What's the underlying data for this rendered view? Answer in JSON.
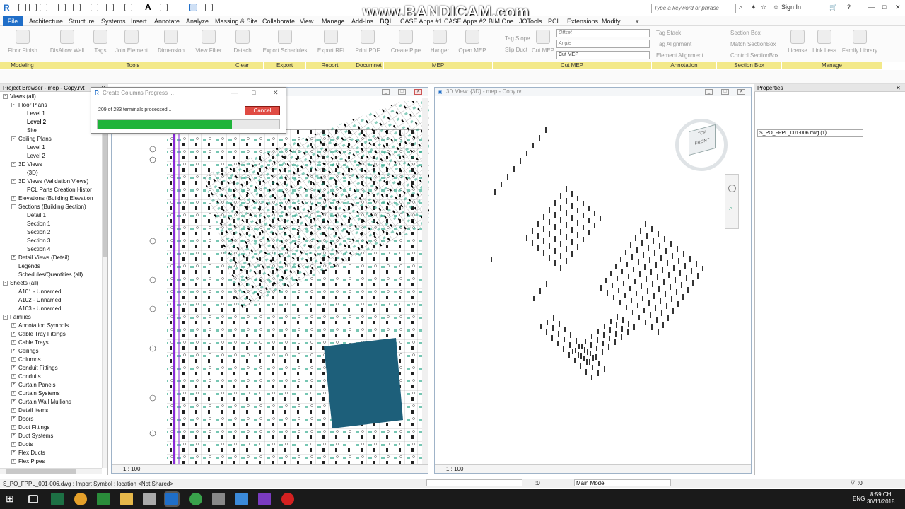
{
  "title_bar": {
    "watermark": "www.BANDICAM.com",
    "search_placeholder": "Type a keyword or phrase",
    "sign_in": "Sign In"
  },
  "menu": {
    "file": "File",
    "tabs": [
      "Architecture",
      "Structure",
      "Systems",
      "Insert",
      "Annotate",
      "Analyze",
      "Massing & Site",
      "Collaborate",
      "View",
      "Manage",
      "Add-Ins",
      "BQL",
      "CASE Apps #1",
      "CASE Apps #2",
      "BIM One",
      "JOTools",
      "PCL",
      "Extensions",
      "Modify"
    ]
  },
  "ribbon": {
    "tools": [
      "Floor Finish",
      "DisAllow Wall",
      "Tags",
      "Join Element",
      "Dimension",
      "View Filter",
      "Detach",
      "Export Schedules",
      "Export RFI",
      "Print PDF",
      "Create Pipe",
      "Hanger",
      "Open MEP"
    ],
    "cut_mep": {
      "tag_slope": "Tag Slope",
      "slip_duct": "Slip Duct",
      "cut_mep_label": "Cut MEP",
      "offset_placeholder": "Offset",
      "angle_placeholder": "Angle",
      "cut_mep_select": "Cut MEP"
    },
    "annotation": {
      "tag_stack": "Tag Stack",
      "tag_alignment": "Tag Alignment",
      "element_alignment": "Element Alignment"
    },
    "section_box": {
      "section_box": "Section Box",
      "match_section_box": "Match SectionBox",
      "control_section_box": "Control SectionBox"
    },
    "manage": [
      "License",
      "Link Less",
      "Family Library"
    ],
    "panels": [
      "Modeling",
      "Tools",
      "Clear",
      "Export",
      "Report",
      "Documnet",
      "MEP",
      "Cut MEP",
      "Annotation",
      "Section Box",
      "Manage"
    ]
  },
  "project_browser": {
    "title": "Project Browser - mep - Copy.rvt",
    "items": [
      {
        "label": "Views (all)",
        "toggle": "-"
      },
      {
        "label": "Floor Plans",
        "toggle": "-"
      },
      {
        "label": "Level 1",
        "toggle": ""
      },
      {
        "label": "Level 2",
        "toggle": ""
      },
      {
        "label": "Site",
        "toggle": ""
      },
      {
        "label": "Ceiling Plans",
        "toggle": "-"
      },
      {
        "label": "Level 1",
        "toggle": ""
      },
      {
        "label": "Level 2",
        "toggle": ""
      },
      {
        "label": "3D Views",
        "toggle": "-"
      },
      {
        "label": "{3D}",
        "toggle": ""
      },
      {
        "label": "3D Views (Validation Views)",
        "toggle": "-"
      },
      {
        "label": "PCL Parts Creation Histor",
        "toggle": ""
      },
      {
        "label": "Elevations (Building Elevation",
        "toggle": "+"
      },
      {
        "label": "Sections (Building Section)",
        "toggle": "-"
      },
      {
        "label": "Detail 1",
        "toggle": ""
      },
      {
        "label": "Section 1",
        "toggle": ""
      },
      {
        "label": "Section 2",
        "toggle": ""
      },
      {
        "label": "Section 3",
        "toggle": ""
      },
      {
        "label": "Section 4",
        "toggle": ""
      },
      {
        "label": "Detail Views (Detail)",
        "toggle": "+"
      },
      {
        "label": "Legends",
        "toggle": ""
      },
      {
        "label": "Schedules/Quantities (all)",
        "toggle": ""
      },
      {
        "label": "Sheets (all)",
        "toggle": "-"
      },
      {
        "label": "A101 - Unnamed",
        "toggle": ""
      },
      {
        "label": "A102 - Unnamed",
        "toggle": ""
      },
      {
        "label": "A103 - Unnamed",
        "toggle": ""
      },
      {
        "label": "Families",
        "toggle": "-"
      },
      {
        "label": "Annotation Symbols",
        "toggle": "+"
      },
      {
        "label": "Cable Tray Fittings",
        "toggle": "+"
      },
      {
        "label": "Cable Trays",
        "toggle": "+"
      },
      {
        "label": "Ceilings",
        "toggle": "+"
      },
      {
        "label": "Columns",
        "toggle": "+"
      },
      {
        "label": "Conduit Fittings",
        "toggle": "+"
      },
      {
        "label": "Conduits",
        "toggle": "+"
      },
      {
        "label": "Curtain Panels",
        "toggle": "+"
      },
      {
        "label": "Curtain Systems",
        "toggle": "+"
      },
      {
        "label": "Curtain Wall Mullions",
        "toggle": "+"
      },
      {
        "label": "Detail Items",
        "toggle": "+"
      },
      {
        "label": "Doors",
        "toggle": "+"
      },
      {
        "label": "Duct Fittings",
        "toggle": "+"
      },
      {
        "label": "Duct Systems",
        "toggle": "+"
      },
      {
        "label": "Ducts",
        "toggle": "+"
      },
      {
        "label": "Flex Ducts",
        "toggle": "+"
      },
      {
        "label": "Flex Pipes",
        "toggle": "+"
      }
    ]
  },
  "dialog": {
    "title": "Create Columns Progress ...",
    "status": "209 of 283 terminals processed...",
    "cancel": "Cancel",
    "processed": 209,
    "total": 283
  },
  "plan_view": {
    "scale": "1 : 100"
  },
  "view3d": {
    "title": "3D View: {3D} - mep - Copy.rvt",
    "scale": "1 : 100",
    "cube_top": "TOP",
    "cube_front": "FRONT"
  },
  "properties": {
    "title": "Properties",
    "selected": "S_PO_FPPL_001-006.dwg (1)"
  },
  "status_bar": {
    "text": "S_PO_FPPL_001-006.dwg : Import Symbol : location <Not Shared>",
    "counter": ":0",
    "workset": "Main Model",
    "filter_count": ":0"
  },
  "taskbar": {
    "time": "8:59 CH",
    "date": "30/11/2018",
    "lang": "ENG"
  },
  "colors": {
    "accent": "#1f6ec8",
    "panel_yellow": "#f3e98a",
    "progress": "#1fb43a",
    "cancel": "#e04b43",
    "selection": "#1d5f7a"
  }
}
